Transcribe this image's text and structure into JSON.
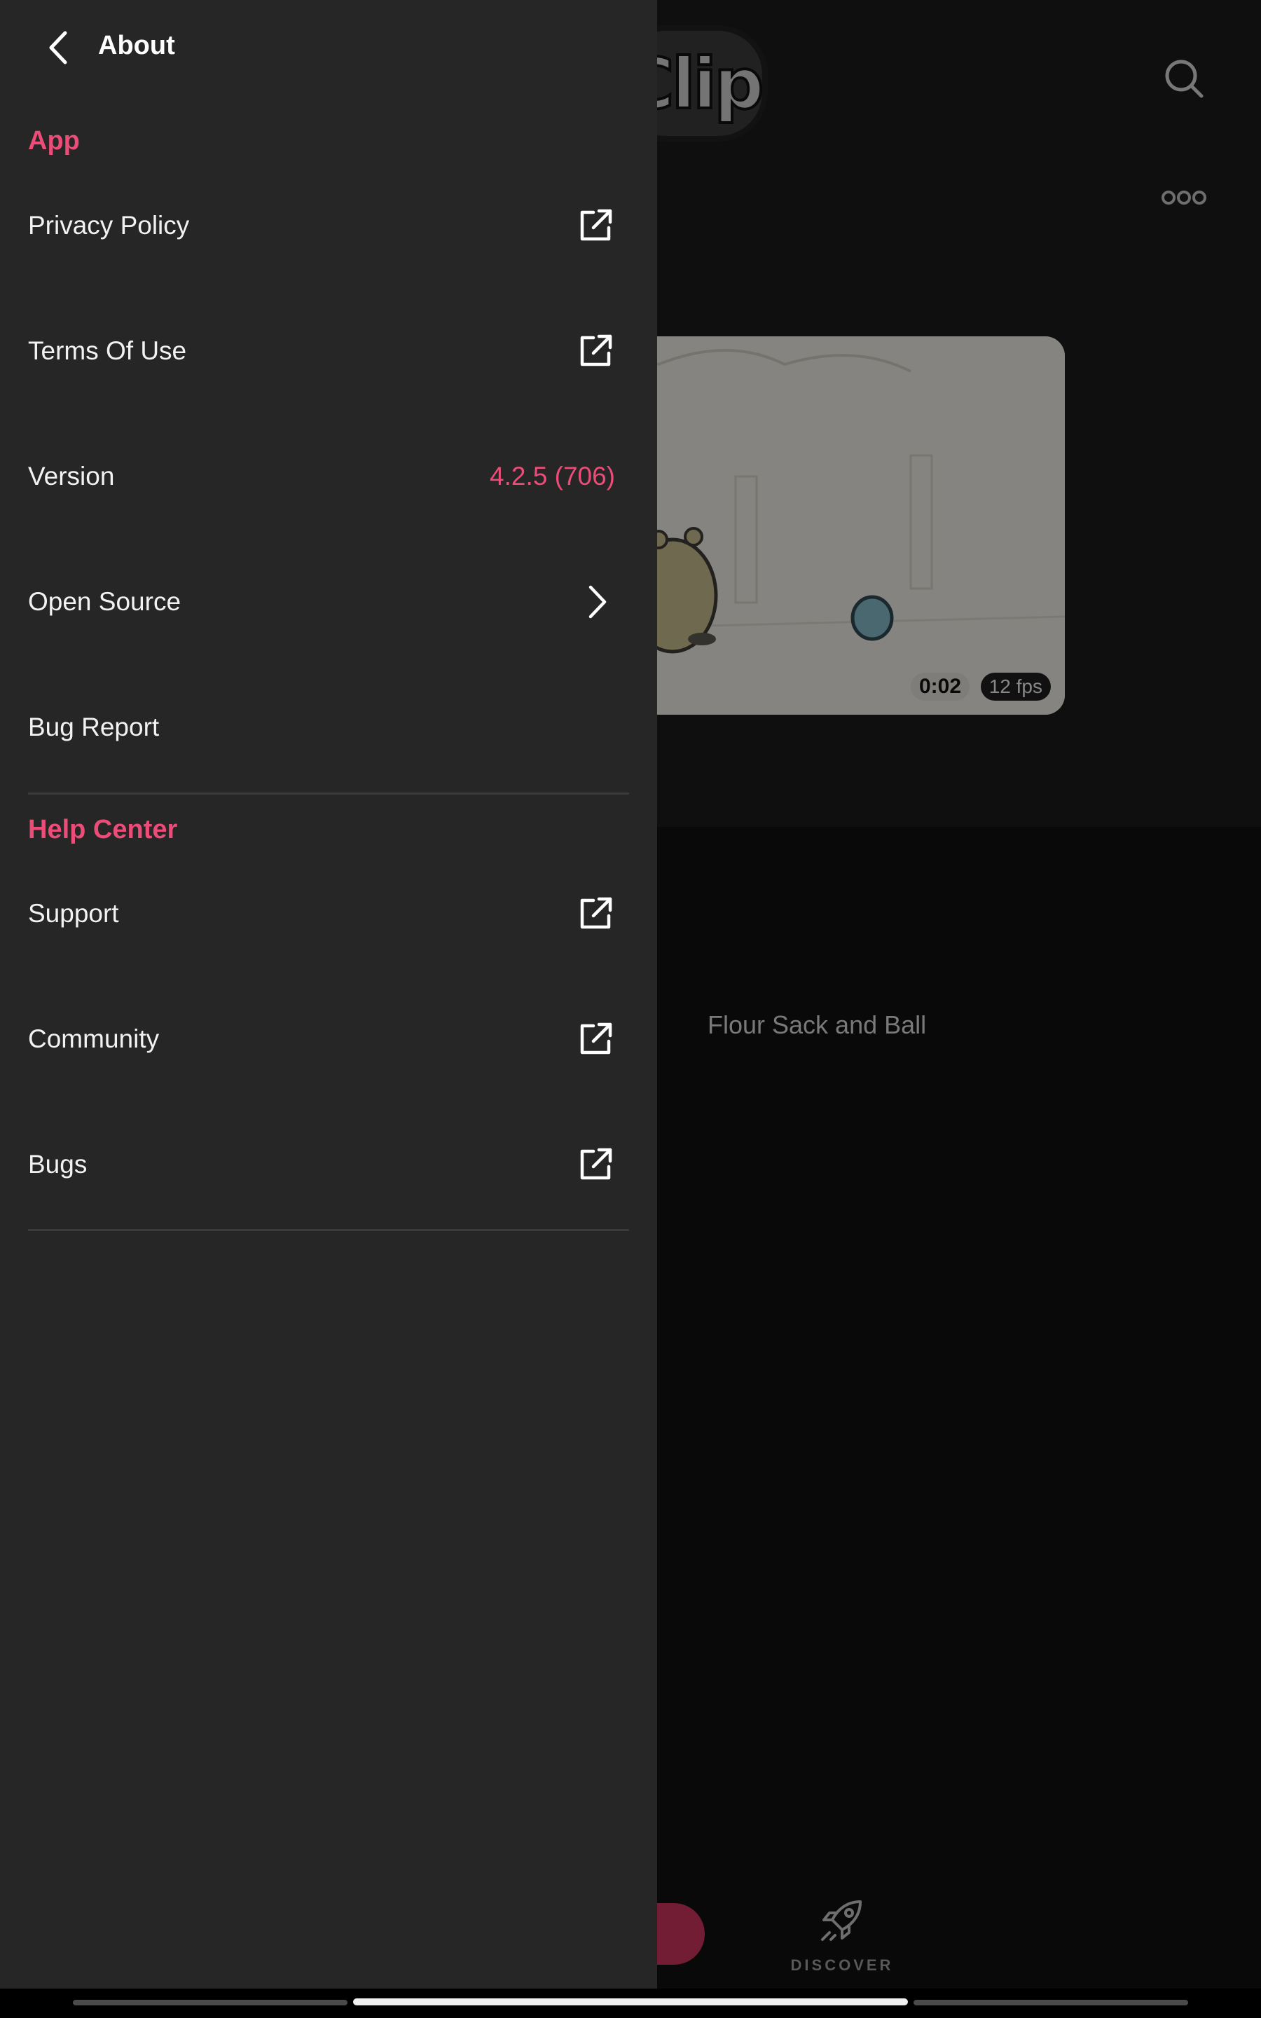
{
  "background": {
    "logo_text": "Clip",
    "video": {
      "duration": "0:02",
      "fps": "12 fps",
      "title": "Flour Sack and Ball"
    },
    "bottom_nav": {
      "discover_label": "DISCOVER"
    }
  },
  "drawer": {
    "title": "About",
    "sections": [
      {
        "label": "App",
        "items": [
          {
            "label": "Privacy Policy",
            "trailing_icon": "external-link-icon"
          },
          {
            "label": "Terms Of Use",
            "trailing_icon": "external-link-icon"
          },
          {
            "label": "Version",
            "value": "4.2.5 (706)"
          },
          {
            "label": "Open Source",
            "trailing_icon": "chevron-right-icon"
          },
          {
            "label": "Bug Report"
          }
        ]
      },
      {
        "label": "Help Center",
        "items": [
          {
            "label": "Support",
            "trailing_icon": "external-link-icon"
          },
          {
            "label": "Community",
            "trailing_icon": "external-link-icon"
          },
          {
            "label": "Bugs",
            "trailing_icon": "external-link-icon"
          }
        ]
      }
    ]
  },
  "colors": {
    "accent": "#ec4d78",
    "drawer_background": "#262626",
    "app_background": "#101010"
  }
}
